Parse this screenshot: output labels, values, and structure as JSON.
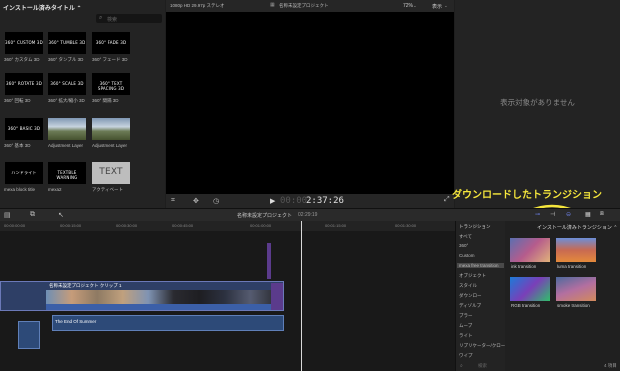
{
  "browser": {
    "title": "インストール済みタイトル ⌃",
    "search_placeholder": "検索",
    "items": [
      {
        "thumb_text": "360° CUSTOM 3D",
        "caption": "360° カスタム 3D"
      },
      {
        "thumb_text": "360° TUMBLE 3D",
        "caption": "360° タンブル 3D"
      },
      {
        "thumb_text": "360° FADE 3D",
        "caption": "360° フェード 3D"
      },
      {
        "thumb_text": "360° ROTATE 3D",
        "caption": "360° 回転 3D"
      },
      {
        "thumb_text": "360° SCALE 3D",
        "caption": "360° 拡大/縮小 3D"
      },
      {
        "thumb_text": "360° TEXT SPACING 3D",
        "caption": "360° 間隔 3D"
      },
      {
        "thumb_text": "360° BASIC 3D",
        "caption": "360° 基本 3D"
      },
      {
        "thumb_text": "",
        "caption": "Adjustment Layer"
      },
      {
        "thumb_text": "",
        "caption": "Adjustment Layer"
      },
      {
        "thumb_text": "ハンドライト",
        "caption": "mexa block title"
      },
      {
        "thumb_text": "TEXTBLE WARNING",
        "caption": "mexa2"
      },
      {
        "thumb_text": "TEXT",
        "caption": "アクティベート"
      }
    ]
  },
  "viewer": {
    "format": "1080p HD 29.97p ステレオ",
    "project": "名称未設定プロジェクト",
    "zoom": "72%",
    "view_menu": "表示",
    "timecode_dim": "00:00",
    "timecode": "2:37:26"
  },
  "inspector": {
    "empty_text": "表示対象がありません"
  },
  "timeline": {
    "project": "名称未設定プロジェクト",
    "duration": "02:29:19",
    "ruler": [
      "00:00:00:00",
      "00:00:15:00",
      "00:00:30:00",
      "00:00:45:00",
      "00:01:00:00",
      "00:01:15:00",
      "00:01:30:00"
    ],
    "clip_label": "名称未設定プロジェクト クリップ 1",
    "audio_label": "The End Of Summer"
  },
  "transitions": {
    "header": "トランジション",
    "browser_title": "インストール済みトランジション ⌃",
    "categories": [
      "すべて",
      "360°",
      "Custom",
      "mexa free transition",
      "オブジェクト",
      "スタイル",
      "ダウンロー",
      "ディゾルブ",
      "ブラー",
      "ムーブ",
      "ライト",
      "リプリケーター/クローン",
      "ワイプ"
    ],
    "selected_category": 3,
    "items": [
      {
        "caption": "ink transition"
      },
      {
        "caption": "luma transition"
      },
      {
        "caption": "RGB transition"
      },
      {
        "caption": "smoke transition"
      }
    ],
    "count": "4 項目",
    "search_placeholder": "検索"
  },
  "annotation": "ダウンロードしたトランジション",
  "colors": {
    "accent": "#f5e63c",
    "clip": "#3a4f7a",
    "audio": "#2d4a78",
    "title_clip": "#5b3b8c"
  }
}
